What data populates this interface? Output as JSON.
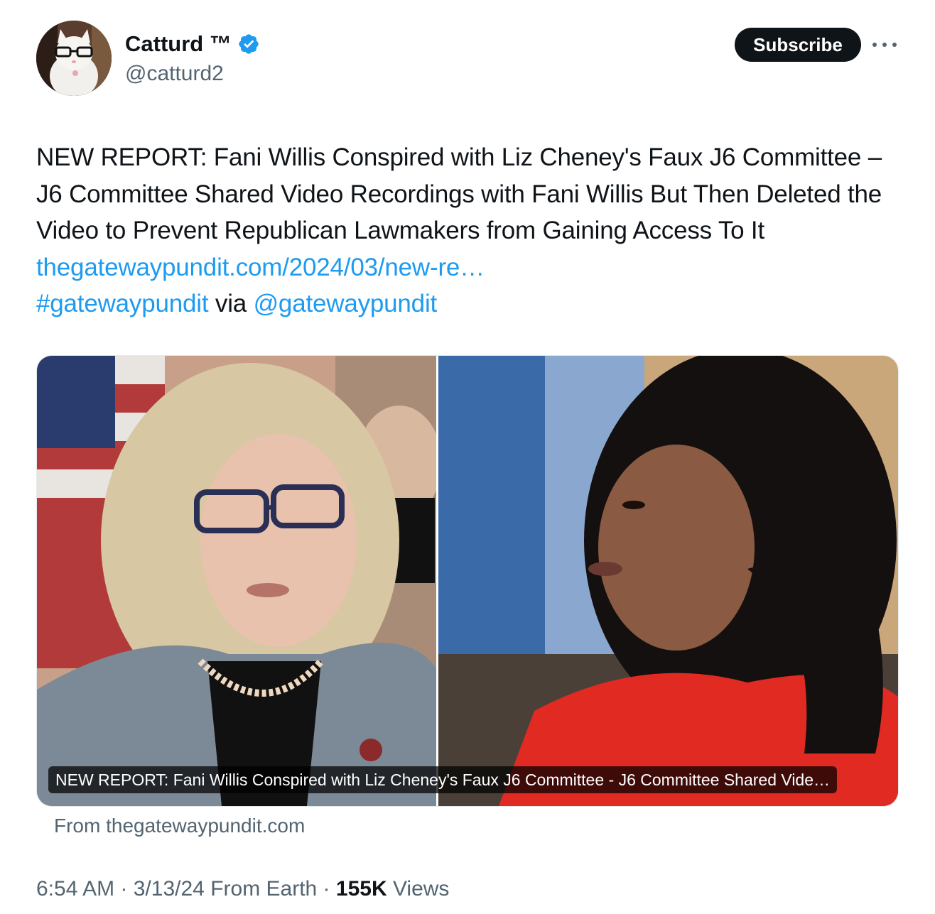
{
  "author": {
    "display_name": "Catturd ™",
    "handle": "@catturd2",
    "avatar_icon": "cat-with-glasses-avatar",
    "verified_icon": "verified-badge-icon"
  },
  "header": {
    "subscribe_label": "Subscribe",
    "more_icon": "more-options-icon"
  },
  "tweet": {
    "text_main": "NEW REPORT: Fani Willis Conspired with Liz Cheney's Faux J6 Committee – J6 Committee Shared Video Recordings with Fani Willis But Then Deleted the Video to Prevent Republican Lawmakers from Gaining Access To It ",
    "link_text": "thegatewaypundit.com/2024/03/new-re…",
    "hashtag": "#gatewaypundit",
    "via_text": " via ",
    "mention": "@gatewaypundit"
  },
  "card": {
    "caption": "NEW REPORT: Fani Willis Conspired with Liz Cheney's Faux J6 Committee - J6 Committee Shared Vide…",
    "source": "From thegatewaypundit.com"
  },
  "meta": {
    "time": "6:54 AM",
    "date": "3/13/24",
    "location": "From Earth",
    "separator": " · ",
    "views_count": "155K",
    "views_label": " Views"
  },
  "colors": {
    "link": "#1d9bf0",
    "text": "#0f1419",
    "secondary": "#536471",
    "verified": "#1d9bf0"
  }
}
